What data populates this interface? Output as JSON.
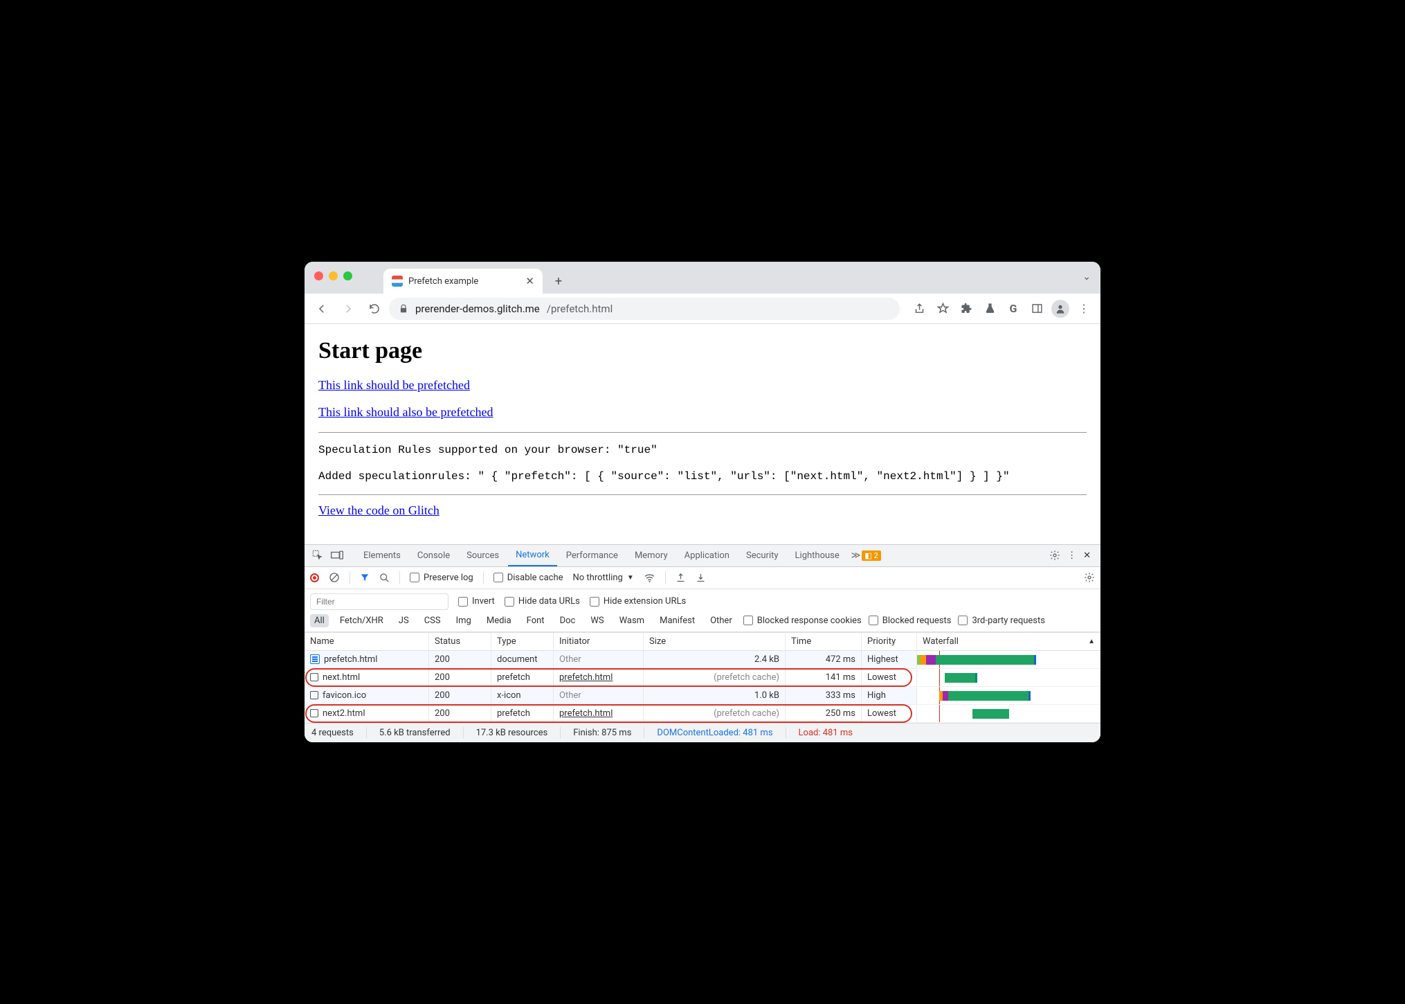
{
  "tab": {
    "title": "Prefetch example"
  },
  "url": {
    "host": "prerender-demos.glitch.me",
    "path": "/prefetch.html"
  },
  "page": {
    "heading": "Start page",
    "link1": "This link should be prefetched",
    "link2": "This link should also be prefetched",
    "code1": "Speculation Rules supported on your browser: \"true\"",
    "code2": "Added speculationrules: \" { \"prefetch\": [ { \"source\": \"list\", \"urls\": [\"next.html\", \"next2.html\"] } ] }\"",
    "link3": "View the code on Glitch"
  },
  "devtools": {
    "tabs": {
      "elements": "Elements",
      "console": "Console",
      "sources": "Sources",
      "network": "Network",
      "performance": "Performance",
      "memory": "Memory",
      "application": "Application",
      "security": "Security",
      "lighthouse": "Lighthouse"
    },
    "issues_count": "2",
    "toolbar": {
      "preserve_log": "Preserve log",
      "disable_cache": "Disable cache",
      "throttling": "No throttling"
    },
    "filter": {
      "placeholder": "Filter",
      "invert": "Invert",
      "hide_data": "Hide data URLs",
      "hide_ext": "Hide extension URLs",
      "types": {
        "all": "All",
        "fetch": "Fetch/XHR",
        "js": "JS",
        "css": "CSS",
        "img": "Img",
        "media": "Media",
        "font": "Font",
        "doc": "Doc",
        "ws": "WS",
        "wasm": "Wasm",
        "manifest": "Manifest",
        "other": "Other"
      },
      "blocked_cookies": "Blocked response cookies",
      "blocked_req": "Blocked requests",
      "thirdparty": "3rd-party requests"
    },
    "columns": {
      "name": "Name",
      "status": "Status",
      "type": "Type",
      "initiator": "Initiator",
      "size": "Size",
      "time": "Time",
      "priority": "Priority",
      "waterfall": "Waterfall"
    },
    "rows": [
      {
        "name": "prefetch.html",
        "status": "200",
        "type": "document",
        "initiator": "Other",
        "initiator_gray": true,
        "size": "2.4 kB",
        "time": "472 ms",
        "priority": "Highest",
        "icon": "doc"
      },
      {
        "name": "next.html",
        "status": "200",
        "type": "prefetch",
        "initiator": "prefetch.html",
        "size": "(prefetch cache)",
        "size_gray": true,
        "time": "141 ms",
        "priority": "Lowest",
        "highlight": true
      },
      {
        "name": "favicon.ico",
        "status": "200",
        "type": "x-icon",
        "initiator": "Other",
        "initiator_gray": true,
        "size": "1.0 kB",
        "time": "333 ms",
        "priority": "High"
      },
      {
        "name": "next2.html",
        "status": "200",
        "type": "prefetch",
        "initiator": "prefetch.html",
        "size": "(prefetch cache)",
        "size_gray": true,
        "time": "250 ms",
        "priority": "Lowest",
        "highlight": true
      }
    ],
    "status": {
      "requests": "4 requests",
      "transferred": "5.6 kB transferred",
      "resources": "17.3 kB resources",
      "finish": "Finish: 875 ms",
      "dcl": "DOMContentLoaded: 481 ms",
      "load": "Load: 481 ms"
    }
  }
}
